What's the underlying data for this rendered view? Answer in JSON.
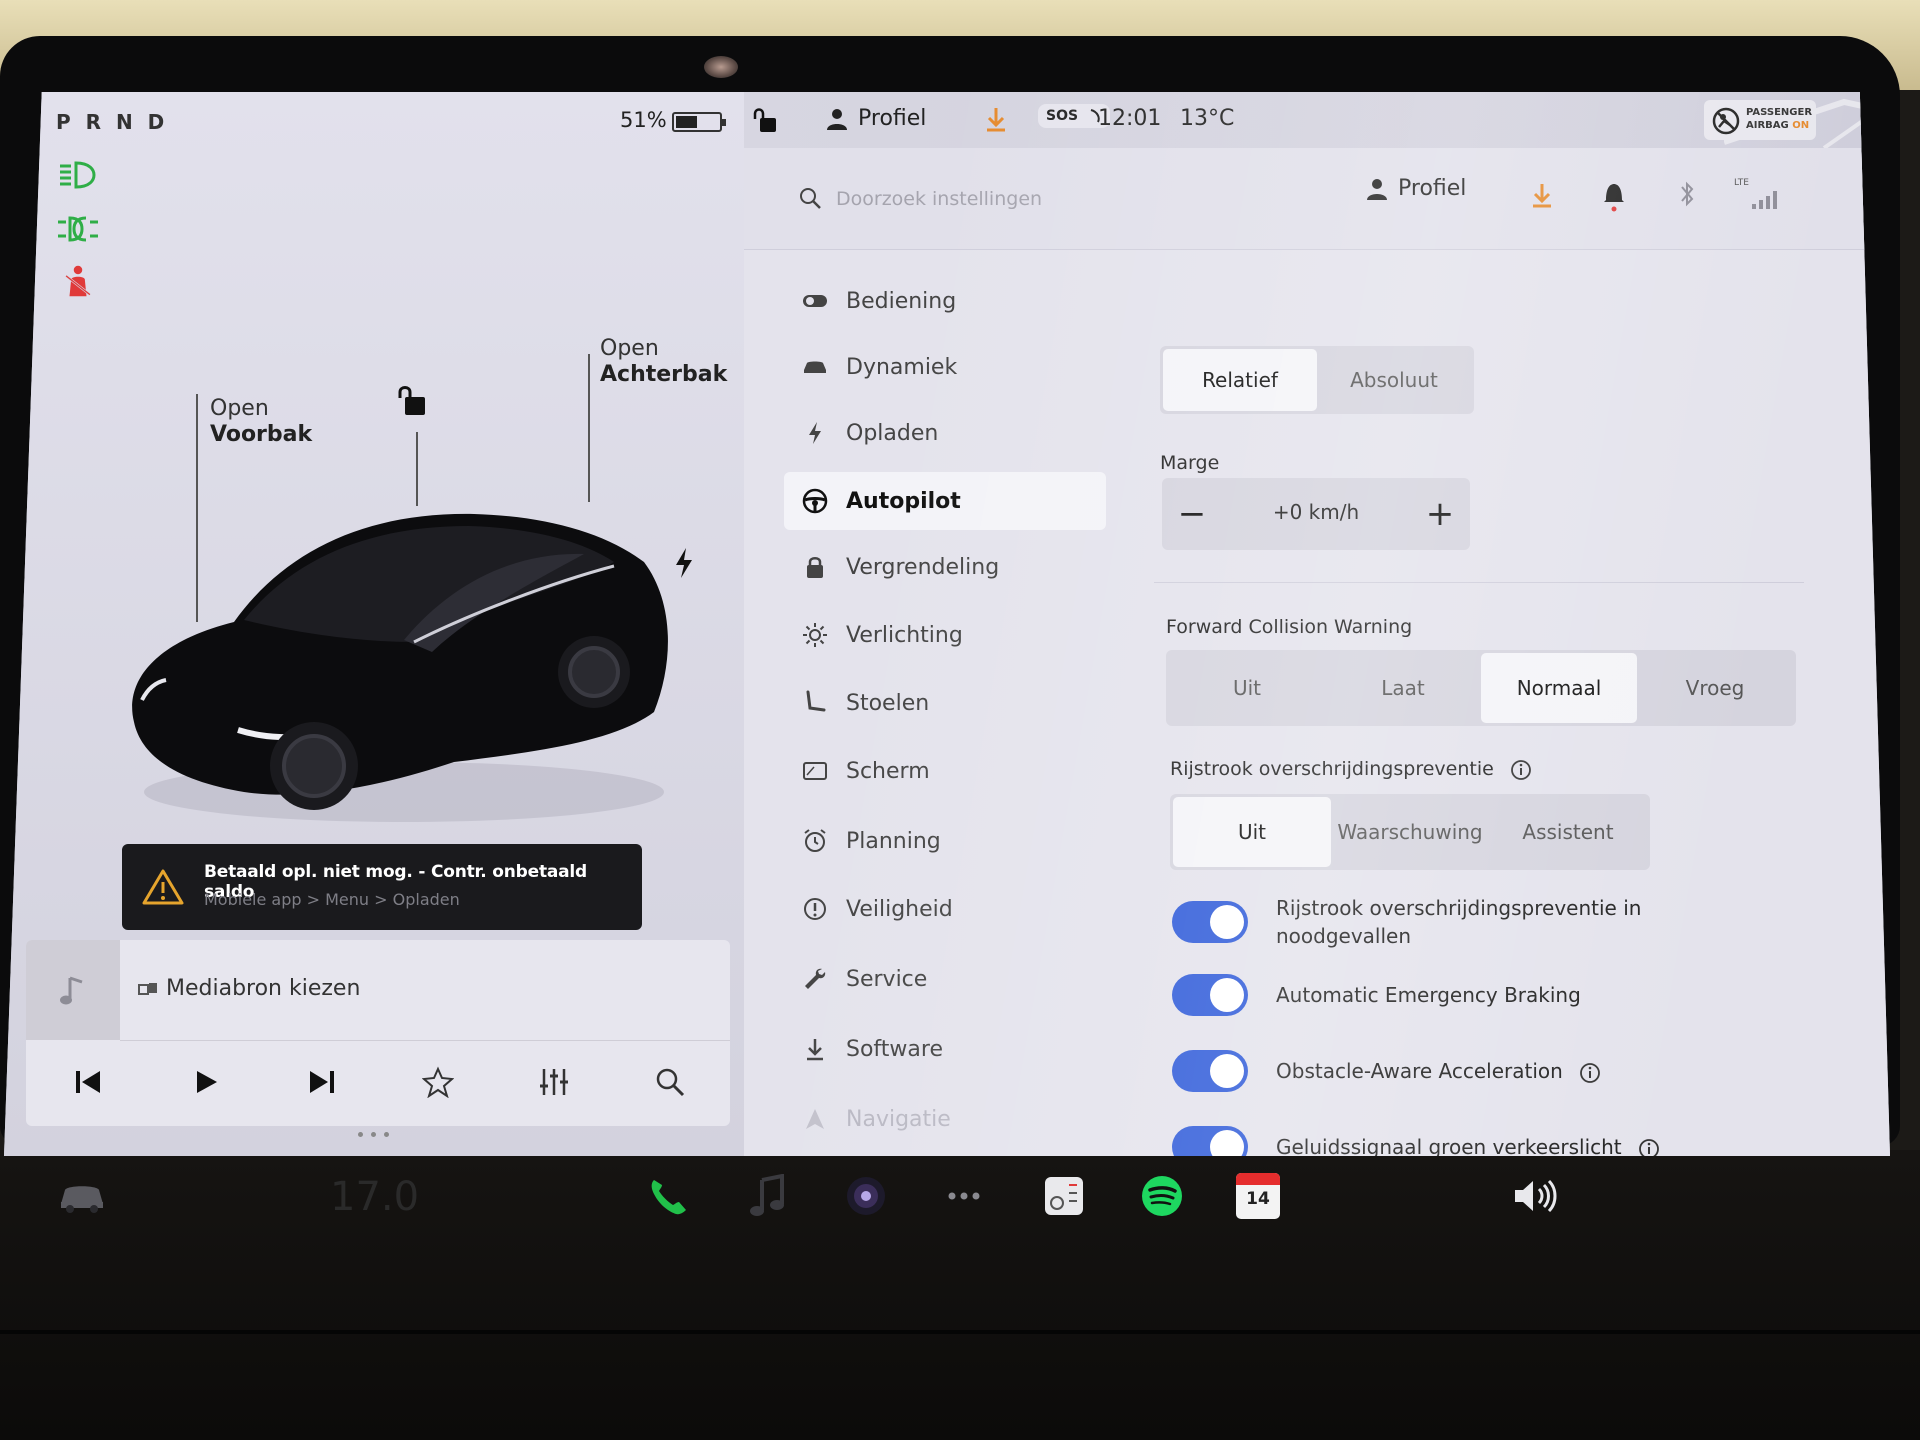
{
  "status_bar": {
    "gear": "P R N D",
    "battery_percent": "51%",
    "battery_level": 0.51,
    "profile_label": "Profiel",
    "sos_label": "SOS",
    "time": "12:01",
    "temperature": "13°C",
    "airbag_line1": "PASSENGER",
    "airbag_line2": "AIRBAG",
    "airbag_state": "ON"
  },
  "car_view": {
    "frunk_top": "Open",
    "frunk_bottom": "Voorbak",
    "trunk_top": "Open",
    "trunk_bottom": "Achterbak"
  },
  "alert": {
    "message": "Betaald opl. niet mog. - Contr. onbetaald saldo",
    "sub": "Mobiele app > Menu > Opladen"
  },
  "media": {
    "source_label": "Mediabron kiezen"
  },
  "search": {
    "placeholder": "Doorzoek instellingen"
  },
  "header": {
    "profile_label": "Profiel",
    "lte_label": "LTE"
  },
  "nav": {
    "items": [
      {
        "label": "Bediening",
        "icon": "toggle-icon"
      },
      {
        "label": "Dynamiek",
        "icon": "car-icon"
      },
      {
        "label": "Opladen",
        "icon": "bolt-icon"
      },
      {
        "label": "Autopilot",
        "icon": "steering-wheel-icon"
      },
      {
        "label": "Vergrendeling",
        "icon": "lock-icon"
      },
      {
        "label": "Verlichting",
        "icon": "sun-icon"
      },
      {
        "label": "Stoelen",
        "icon": "seat-icon"
      },
      {
        "label": "Scherm",
        "icon": "display-icon"
      },
      {
        "label": "Planning",
        "icon": "alarm-clock-icon"
      },
      {
        "label": "Veiligheid",
        "icon": "info-circle-icon"
      },
      {
        "label": "Service",
        "icon": "wrench-icon"
      },
      {
        "label": "Software",
        "icon": "download-icon"
      },
      {
        "label": "Navigatie",
        "icon": "navigation-icon"
      }
    ],
    "active_index": 3
  },
  "autopilot": {
    "speed_mode": {
      "options": [
        "Relatief",
        "Absoluut"
      ],
      "selected": "Relatief"
    },
    "margin": {
      "label": "Marge",
      "value": "+0 km/h",
      "minus": "−",
      "plus": "+"
    },
    "fcw": {
      "label": "Forward Collision Warning",
      "options": [
        "Uit",
        "Laat",
        "Normaal",
        "Vroeg"
      ],
      "selected": "Normaal"
    },
    "lane": {
      "label": "Rijstrook overschrijdingspreventie",
      "options": [
        "Uit",
        "Waarschuwing",
        "Assistent"
      ],
      "selected": "Uit"
    },
    "toggles": [
      {
        "label": "Rijstrook overschrijdingspreventie in noodgevallen",
        "on": true
      },
      {
        "label": "Automatic Emergency Braking",
        "on": true
      },
      {
        "label": "Obstacle-Aware Acceleration",
        "on": true
      },
      {
        "label": "Geluidssignaal groen verkeerslicht",
        "on": true
      }
    ]
  },
  "dock": {
    "climate_temp": "17.0",
    "calendar_day": "14"
  },
  "colors": {
    "toggle_on": "#2f5bd9",
    "headlight_green": "#2fae47",
    "seatbelt_red": "#e03a3a",
    "download_orange": "#e58a2d",
    "spotify_green": "#1ed760",
    "phone_green": "#21c04a"
  }
}
